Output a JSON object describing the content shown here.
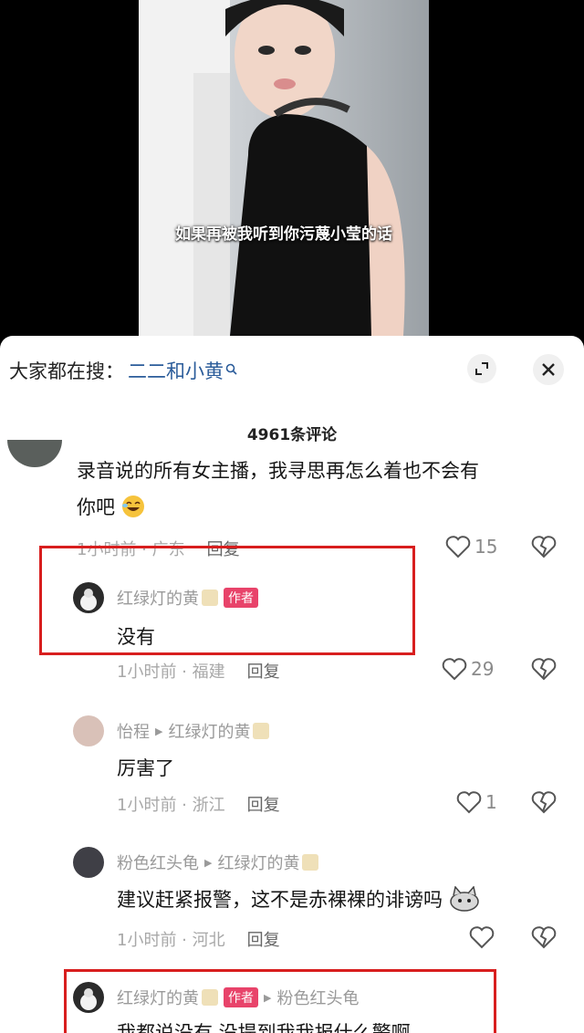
{
  "video": {
    "subtitle": "如果再被我听到你污蔑小莹的话"
  },
  "search": {
    "prefix": "大家都在搜：",
    "term": "二二和小黄"
  },
  "comments_header": {
    "count_label": "4961条评论"
  },
  "comments": [
    {
      "text_line1": "录音说的所有女主播，我寻思再怎么着也不会有",
      "text_line2": "你吧",
      "meta": "1小时前 · 广东",
      "reply": "回复",
      "likes": "15"
    },
    {
      "user": "红绿灯的黄",
      "badge": "作者",
      "text": "没有",
      "meta": "1小时前 · 福建",
      "reply": "回复",
      "likes": "29"
    },
    {
      "user": "怡程",
      "reply_to": "红绿灯的黄",
      "text": "厉害了",
      "meta": "1小时前 · 浙江",
      "reply": "回复",
      "likes": "1"
    },
    {
      "user": "粉色红头龟",
      "reply_to": "红绿灯的黄",
      "text": "建议赶紧报警，这不是赤裸裸的诽谤吗",
      "meta": "1小时前 · 河北",
      "reply": "回复",
      "likes": ""
    },
    {
      "user": "红绿灯的黄",
      "badge": "作者",
      "reply_to": "粉色红头龟",
      "text": "我都说没有 没提到我我报什么警啊"
    }
  ],
  "colors": {
    "highlight_box": "#d81e1e",
    "author_badge": "#e8436a",
    "search_term": "#2b5c9a"
  },
  "icons": {
    "search": "search-icon",
    "expand": "expand-icon",
    "close": "close-icon",
    "like": "heart-icon",
    "dislike": "broken-heart-icon"
  }
}
